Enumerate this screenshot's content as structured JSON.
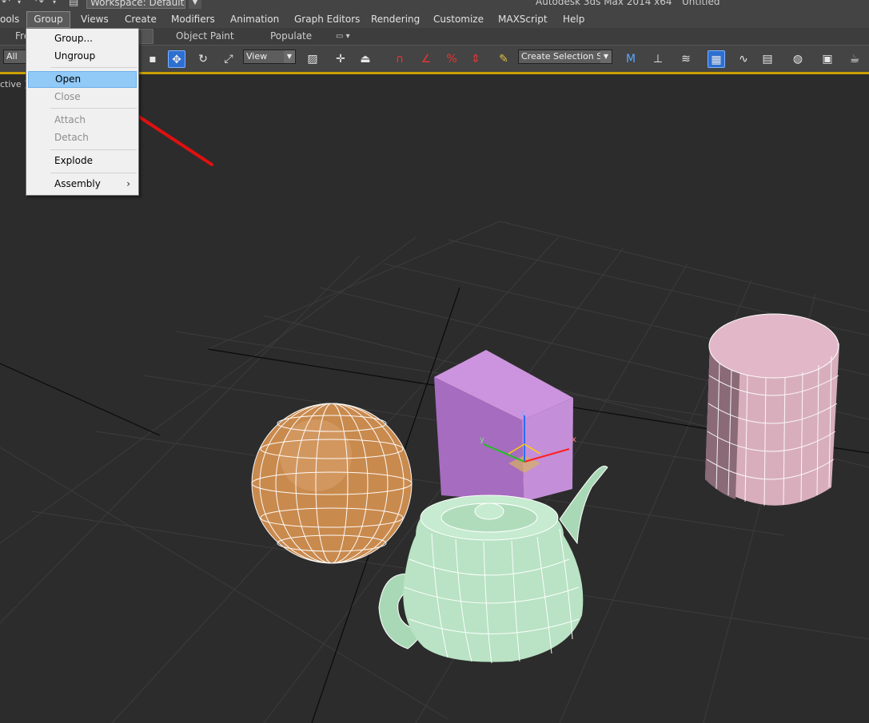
{
  "app": {
    "title": "Autodesk 3ds Max  2014 x64",
    "document": "Untitled",
    "workspace": "Workspace: Default"
  },
  "menubar": {
    "items": [
      "ools",
      "Group",
      "Views",
      "Create",
      "Modifiers",
      "Animation",
      "Graph Editors",
      "Rendering",
      "Customize",
      "MAXScript",
      "Help"
    ],
    "active": "Group"
  },
  "ribbon": {
    "tabs": [
      "Fre",
      "Object Paint",
      "Populate"
    ]
  },
  "toolbar": {
    "filter_value": "All",
    "coord_system_value": "View",
    "selection_set_value": "Create Selection Set"
  },
  "viewport": {
    "label": "ctive ]",
    "gizmo_axes": [
      "x",
      "y",
      "z"
    ]
  },
  "group_menu": {
    "items": [
      {
        "label": "Group...",
        "enabled": true
      },
      {
        "label": "Ungroup",
        "enabled": true
      },
      {
        "label": "Open",
        "enabled": true,
        "highlighted": true
      },
      {
        "label": "Close",
        "enabled": false
      },
      {
        "label": "Attach",
        "enabled": false
      },
      {
        "label": "Detach",
        "enabled": false
      },
      {
        "label": "Explode",
        "enabled": true
      },
      {
        "label": "Assembly",
        "enabled": true,
        "submenu": true
      }
    ],
    "submenu_glyph": "›"
  },
  "colors": {
    "annotation_arrow": "#e01010",
    "menu_highlight": "#91c9f7",
    "sphere": "#c98a4e",
    "box": "#c48fd8",
    "cylinder": "#e2b8c8",
    "teapot": "#b9e3c4",
    "wireframe": "#ffffff",
    "grid": "#3a3a3a",
    "home_grid_axis": "#0a0a0a"
  }
}
